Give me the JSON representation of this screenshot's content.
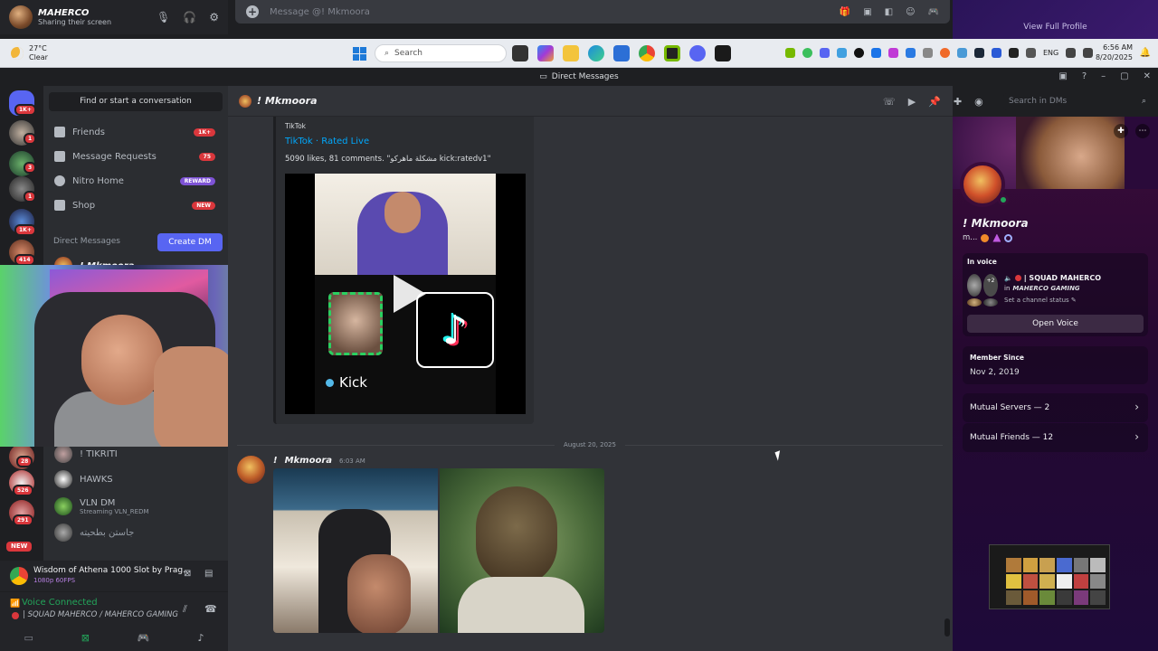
{
  "top_panel": {
    "username": "MAHERCO",
    "status": "Sharing their screen",
    "message_placeholder": "Message @! Mkmoora",
    "view_profile": "View Full Profile"
  },
  "taskbar": {
    "temp": "27°C",
    "condition": "Clear",
    "search_placeholder": "Search",
    "lang": "ENG",
    "time": "6:56 AM",
    "date": "8/20/2025"
  },
  "window": {
    "title": "Direct Messages"
  },
  "servers": [
    {
      "badge": "1K+"
    },
    {
      "badge": "1"
    },
    {
      "badge": "3"
    },
    {
      "badge": "1"
    },
    {
      "badge": "1K+"
    },
    {
      "badge": "414"
    },
    {
      "badge": "28"
    },
    {
      "badge": "526"
    },
    {
      "badge": "291"
    },
    {
      "badge": "NEW"
    }
  ],
  "sidebar": {
    "find": "Find or start a conversation",
    "nav": [
      {
        "label": "Friends",
        "pill": "1K+"
      },
      {
        "label": "Message Requests",
        "pill": "75"
      },
      {
        "label": "Nitro Home",
        "pill": "REWARD"
      },
      {
        "label": "Shop",
        "pill": "NEW"
      }
    ],
    "dm_header": "Direct Messages",
    "create_dm": "Create DM",
    "dms": [
      {
        "name": "! Mkmoora",
        "sub": ""
      },
      {
        "name": "! TIKRITI",
        "sub": ""
      },
      {
        "name": "HAWKS",
        "sub": ""
      },
      {
        "name": "VLN DM",
        "sub": "Streaming VLN_REDM"
      },
      {
        "name": "جاستن بطحيته",
        "sub": ""
      }
    ]
  },
  "activity": {
    "title": "Wisdom of Athena 1000 Slot by Prag...",
    "quality": "1080p 60FPS"
  },
  "voice": {
    "status": "Voice Connected",
    "channel": "| SQUAD MAHERCO / MAHERCO GAMING"
  },
  "chat": {
    "header_name": "! Mkmoora",
    "search_placeholder": "Search in DMs",
    "embed": {
      "provider": "TikTok",
      "title": "TikTok · Rated Live",
      "desc": "5090 likes, 81 comments. \"مشكلة ماهركو kick:ratedv1\"",
      "kick": "Kick"
    },
    "date_separator": "August 20, 2025",
    "message": {
      "author": "Mkmoora",
      "prefix": "!",
      "time": "6:03 AM"
    }
  },
  "profile": {
    "name": "! Mkmoora",
    "tag": "m...",
    "in_voice": "In voice",
    "voice_channel": "| SQUAD MAHERCO",
    "voice_server": "MAHERCO GAMING",
    "voice_in": "in",
    "voice_count": "+2",
    "set_status": "Set a channel status",
    "open_voice": "Open Voice",
    "member_since_label": "Member Since",
    "member_since": "Nov 2, 2019",
    "mutual_servers": "Mutual Servers — 2",
    "mutual_friends": "Mutual Friends — 12"
  },
  "colors": {
    "accent": "#5865f2",
    "danger": "#da373c",
    "online": "#23a55a",
    "link": "#00a8fc"
  }
}
